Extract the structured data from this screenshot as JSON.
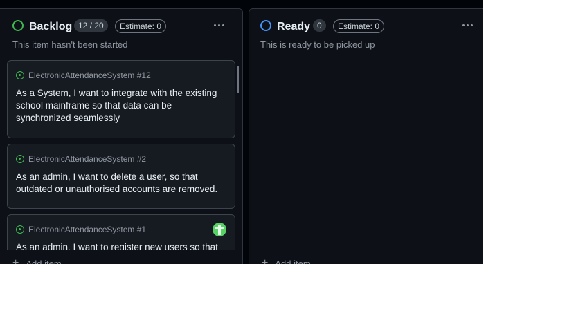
{
  "columns": [
    {
      "title": "Backlog",
      "count": "12 / 20",
      "estimate": "Estimate: 0",
      "description": "This item hasn't been started",
      "status_color": "#3fb950",
      "add_label": "Add item",
      "cards": [
        {
          "ref": "ElectronicAttendanceSystem #12",
          "text": "As a System, I want to integrate with the existing school mainframe so that data can be synchronized seamlessly"
        },
        {
          "ref": "ElectronicAttendanceSystem #2",
          "text": "As an admin, I want to delete a user, so that outdated or unauthorised accounts are removed."
        },
        {
          "ref": "ElectronicAttendanceSystem #1",
          "text": "As an admin, I want to register new users so that"
        }
      ]
    },
    {
      "title": "Ready",
      "count": "0",
      "estimate": "Estimate: 0",
      "description": "This is ready to be picked up",
      "status_color": "#4493f8",
      "add_label": "Add item",
      "cards": []
    }
  ]
}
